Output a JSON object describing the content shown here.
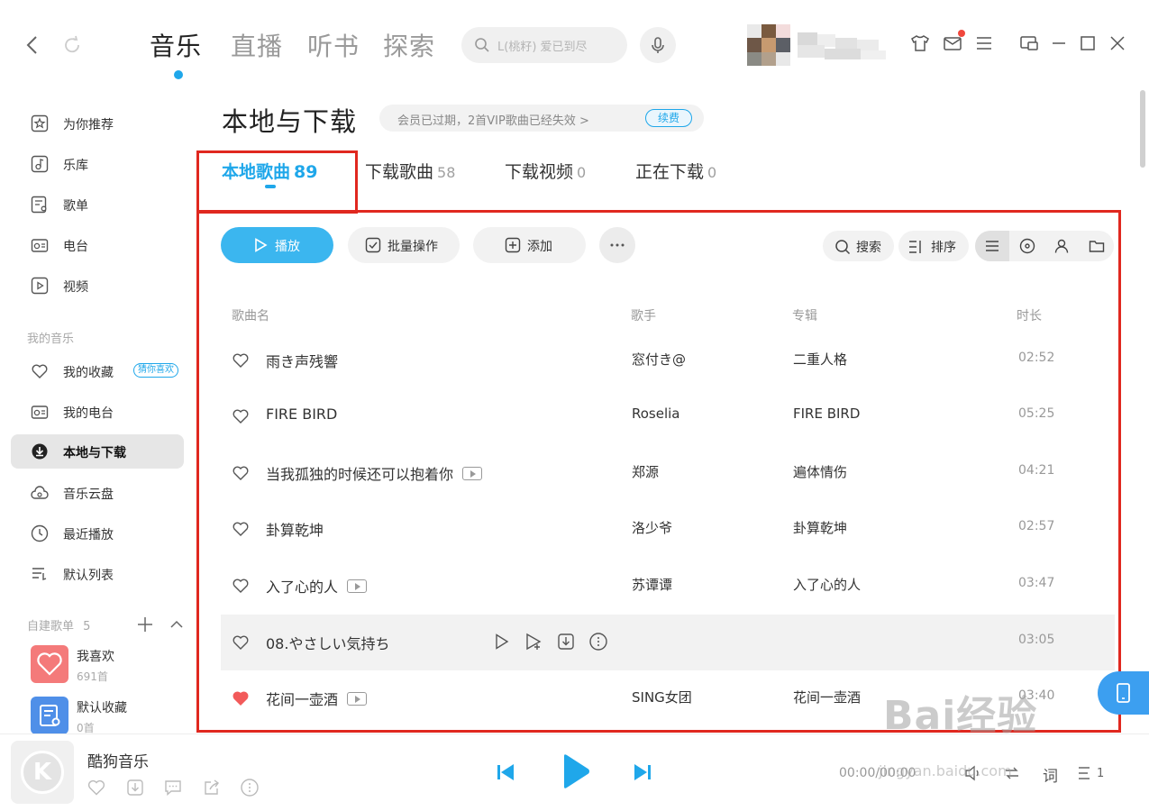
{
  "topbar": {
    "tabs": [
      "音乐",
      "直播",
      "听书",
      "探索"
    ],
    "active_tab": "音乐",
    "search_placeholder": "L(桃籽) 爱已到尽"
  },
  "sidebar": {
    "main_items": [
      {
        "label": "为你推荐",
        "icon": "star-icon"
      },
      {
        "label": "乐库",
        "icon": "music-library-icon"
      },
      {
        "label": "歌单",
        "icon": "playlist-icon"
      },
      {
        "label": "电台",
        "icon": "radio-icon"
      },
      {
        "label": "视频",
        "icon": "video-icon"
      }
    ],
    "my_music_header": "我的音乐",
    "my_items": [
      {
        "label": "我的收藏",
        "icon": "heart-icon"
      },
      {
        "label": "我的电台",
        "icon": "radio-icon"
      },
      {
        "label": "本地与下载",
        "icon": "download-icon"
      },
      {
        "label": "音乐云盘",
        "icon": "cloud-icon"
      },
      {
        "label": "最近播放",
        "icon": "clock-icon"
      },
      {
        "label": "默认列表",
        "icon": "list-icon"
      }
    ],
    "guess_tag": "猜你喜欢",
    "playlists_header": "自建歌单",
    "playlists_count": "5",
    "playlists": [
      {
        "name": "我喜欢",
        "count": "691首"
      },
      {
        "name": "默认收藏",
        "count": "0首"
      }
    ]
  },
  "main": {
    "page_title": "本地与下载",
    "vip_notice": "会员已过期，2首VIP歌曲已经失效 >",
    "renew_label": "续费",
    "tabs": [
      {
        "label": "本地歌曲",
        "count": "89"
      },
      {
        "label": "下载歌曲",
        "count": "58"
      },
      {
        "label": "下载视频",
        "count": "0"
      },
      {
        "label": "正在下载",
        "count": "0"
      }
    ],
    "toolbar": {
      "play": "播放",
      "batch": "批量操作",
      "add": "添加",
      "more": "···",
      "search": "搜索",
      "sort": "排序"
    },
    "columns": [
      "歌曲名",
      "歌手",
      "专辑",
      "时长"
    ],
    "songs": [
      {
        "title": "雨き声残響",
        "artist": "窓付き@",
        "album": "二重人格",
        "duration": "02:52",
        "liked": false,
        "mv": false
      },
      {
        "title": "FIRE BIRD",
        "artist": "Roselia",
        "album": "FIRE BIRD",
        "duration": "05:25",
        "liked": false,
        "mv": false
      },
      {
        "title": "当我孤独的时候还可以抱着你",
        "artist": "郑源",
        "album": "遍体情伤",
        "duration": "04:21",
        "liked": false,
        "mv": true
      },
      {
        "title": "卦算乾坤",
        "artist": "洛少爷",
        "album": "卦算乾坤",
        "duration": "02:57",
        "liked": false,
        "mv": false
      },
      {
        "title": "入了心的人",
        "artist": "苏谭谭",
        "album": "入了心的人",
        "duration": "03:47",
        "liked": false,
        "mv": true
      },
      {
        "title": "08.やさしい気持ち",
        "artist": "",
        "album": "",
        "duration": "03:05",
        "liked": false,
        "mv": false
      },
      {
        "title": "花间一壶酒",
        "artist": "SING女团",
        "album": "花间一壶酒",
        "duration": "03:40",
        "liked": true,
        "mv": true
      }
    ]
  },
  "player": {
    "title": "酷狗音乐",
    "time": "00:00/00:00",
    "cover_letter": "K",
    "lyrics_label": "词",
    "queue_count": "1"
  },
  "watermark": {
    "text": "Bai经验",
    "url": "jingyan.baidu.com"
  },
  "colors": {
    "accent": "#1fa7ea",
    "play_button": "#3bb6ef",
    "highlight_box": "#e0281f",
    "liked": "#f25a5a",
    "active_sidebar": "#e6e6e6"
  }
}
